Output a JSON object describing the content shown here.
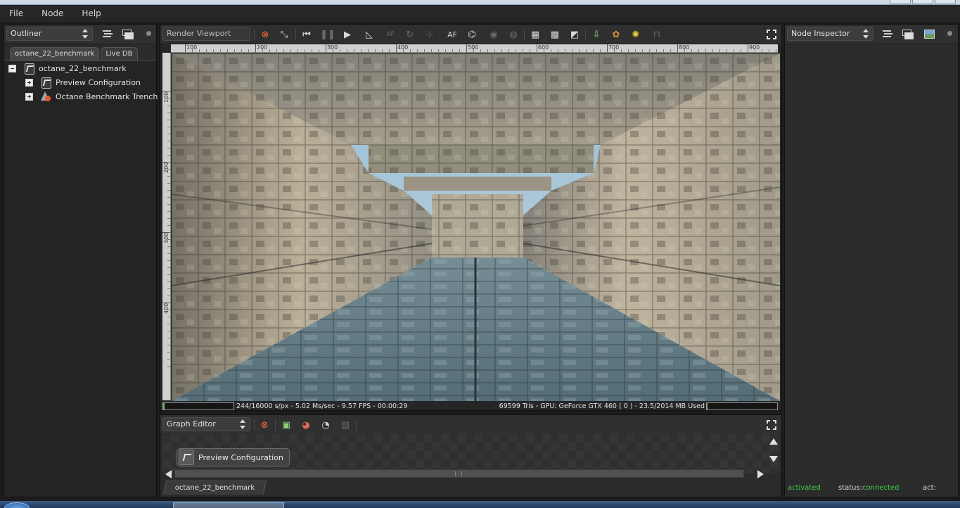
{
  "menu": [
    "File",
    "Node",
    "Help"
  ],
  "outliner": {
    "panel_title": "Outliner",
    "tabs": [
      "octane_22_benchmark",
      "Live DB"
    ],
    "tree": [
      {
        "label": "octane_22_benchmark",
        "expander": "minus",
        "icon": "graph-node-icon"
      },
      {
        "label": "Preview Configuration",
        "expander": "plus",
        "icon": "graph-node-icon"
      },
      {
        "label": "Octane Benchmark Trench (CL",
        "expander": "plus",
        "icon": "mesh-node-icon"
      }
    ]
  },
  "viewport": {
    "title": "Render Viewport",
    "toolbar_af_label": "AF",
    "ruler_h": [
      "100",
      "200",
      "300",
      "400",
      "500",
      "600",
      "700",
      "800",
      "900"
    ],
    "ruler_v": [
      "100",
      "200",
      "300",
      "400"
    ],
    "status_left": "244/16000 s/px - 5.02 Ms/sec - 9.57 FPS - 00:00:29",
    "status_right": "69599 Tris - GPU: GeForce GTX 460 ( 0 ) - 23.5/2014 MB Used",
    "render_progress_fraction": 0.015,
    "gpu_memory_fraction": 0.012
  },
  "graph_editor": {
    "title": "Graph Editor",
    "node_label": "Preview Configuration",
    "tab_label": "octane_22_benchmark"
  },
  "inspector": {
    "title": "Node Inspector",
    "status_state": "activated",
    "status_label": "status:",
    "status_value": "connected",
    "act_label": "act:"
  },
  "colors": {
    "panel_bg": "#2b2b2b",
    "accent_green": "#3fd04a",
    "menubar_bg": "#262626"
  }
}
